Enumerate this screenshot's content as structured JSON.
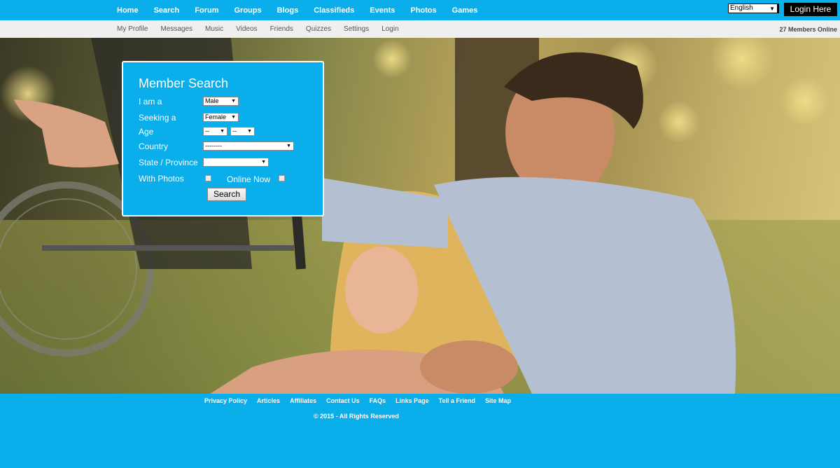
{
  "topnav": {
    "items": [
      "Home",
      "Search",
      "Forum",
      "Groups",
      "Blogs",
      "Classifieds",
      "Events",
      "Photos",
      "Games"
    ],
    "language": "English",
    "login_label": "Login Here"
  },
  "subnav": {
    "items": [
      "My Profile",
      "Messages",
      "Music",
      "Videos",
      "Friends",
      "Quizzes",
      "Settings",
      "Login"
    ],
    "members_online": "27 Members Online"
  },
  "search": {
    "title": "Member Search",
    "i_am_label": "I am a",
    "i_am_value": "Male",
    "seeking_label": "Seeking a",
    "seeking_value": "Female",
    "age_label": "Age",
    "age_min": "--",
    "age_max": "--",
    "country_label": "Country",
    "country_value": "--------",
    "state_label": "State / Province",
    "state_value": "",
    "photos_label": "With Photos",
    "online_label": "Online Now",
    "button_label": "Search"
  },
  "footer": {
    "links": [
      "Privacy Policy",
      "Articles",
      "Affiliates",
      "Contact Us",
      "FAQs",
      "Links Page",
      "Tell a Friend",
      "Site Map"
    ],
    "copyright": "© 2015 - All Rights Reserved"
  },
  "colors": {
    "brand": "#0aaeea",
    "subnav_bg": "#efefef"
  }
}
